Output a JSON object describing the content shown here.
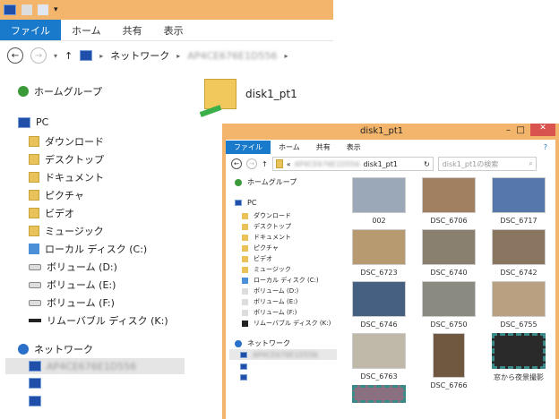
{
  "outer": {
    "tabs": [
      "ファイル",
      "ホーム",
      "共有",
      "表示"
    ],
    "path": [
      "ネットワーク",
      "AP4CE676E1D556"
    ],
    "folder": "disk1_pt1",
    "nav": {
      "homegroup": "ホームグループ",
      "pc": "PC",
      "items": [
        "ダウンロード",
        "デスクトップ",
        "ドキュメント",
        "ピクチャ",
        "ビデオ",
        "ミュージック",
        "ローカル ディスク (C:)",
        "ボリューム (D:)",
        "ボリューム (E:)",
        "ボリューム (F:)",
        "リムーバブル ディスク (K:)"
      ],
      "network": "ネットワーク",
      "hosts": [
        "AP4CE676E1D556"
      ]
    }
  },
  "inner": {
    "title": "disk1_pt1",
    "tabs": [
      "ファイル",
      "ホーム",
      "共有",
      "表示"
    ],
    "path": [
      "«",
      "AP4CE676E1D556",
      "disk1_pt1"
    ],
    "search_placeholder": "disk1_pt1の検索",
    "files": [
      "002",
      "DSC_6706",
      "DSC_6717",
      "DSC_6723",
      "DSC_6740",
      "DSC_6742",
      "DSC_6746",
      "DSC_6750",
      "DSC_6755",
      "DSC_6763",
      "DSC_6766",
      "窓から夜景撮影"
    ]
  },
  "colors": {
    "title": "#f3b56b",
    "file_tab": "#1979ca"
  }
}
